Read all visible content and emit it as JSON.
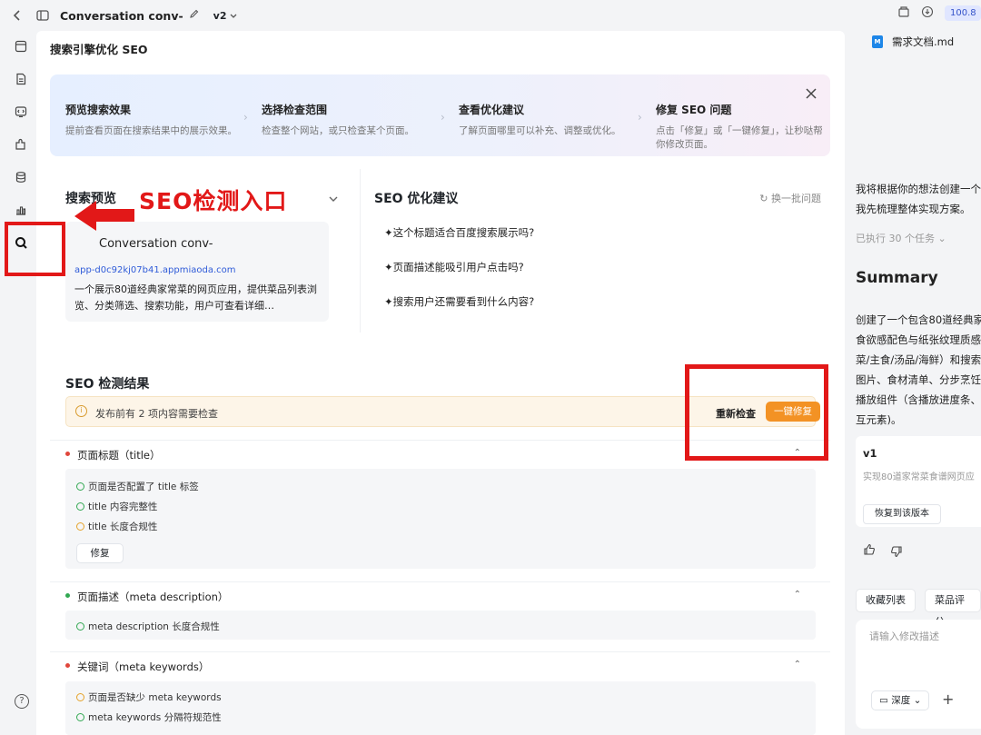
{
  "topbar": {
    "title": "Conversation conv-",
    "version": "v2",
    "zoom": "100.8"
  },
  "main": {
    "page_title": "搜索引擎优化 SEO",
    "steps": [
      {
        "title": "预览搜索效果",
        "desc": "提前查看页面在搜索结果中的展示效果。"
      },
      {
        "title": "选择检查范围",
        "desc": "检查整个网站，或只检查某个页面。"
      },
      {
        "title": "查看优化建议",
        "desc": "了解页面哪里可以补充、调整或优化。"
      },
      {
        "title": "修复 SEO 问题",
        "desc": "点击「修复」或「一键修复」，让秒哒帮你修改页面。"
      }
    ],
    "preview": {
      "title": "搜索预览",
      "site_name": "Conversation conv-",
      "url": "app-d0c92kj07b41.appmiaoda.com",
      "description": "一个展示80道经典家常菜的网页应用，提供菜品列表浏览、分类筛选、搜索功能，用户可查看详细…"
    },
    "suggestions": {
      "title": "SEO 优化建议",
      "refresh": "换一批问题",
      "items": [
        "这个标题适合百度搜索展示吗?",
        "页面描述能吸引用户点击吗?",
        "搜索用户还需要看到什么内容?"
      ]
    },
    "annotation": "SEO检测入口",
    "results": {
      "title": "SEO 检测结果",
      "warning": "发布前有 2 项内容需要检查",
      "recheck": "重新检查",
      "fix_all": "一键修复",
      "sections": [
        {
          "label": "页面标题（title）",
          "checks": [
            "页面是否配置了 title 标签",
            "title 内容完整性",
            "title 长度合规性"
          ],
          "fix": "修复"
        },
        {
          "label": "页面描述（meta description）",
          "checks": [
            "meta description 长度合规性"
          ]
        },
        {
          "label": "关键词（meta keywords）",
          "checks": [
            "页面是否缺少 meta keywords",
            "meta keywords 分隔符规范性"
          ]
        }
      ]
    }
  },
  "right": {
    "doc": "需求文档.md",
    "intro_line1": "我将根据你的想法创建一个",
    "intro_line2": "我先梳理整体实现方案。",
    "tasks": "已执行 30 个任务",
    "summary_title": "Summary",
    "summary_lines": [
      "创建了一个包含80道经典家",
      "食欲感配色与纸张纹理质感",
      "菜/主食/汤品/海鲜）和搜索",
      "图片、食材清单、分步烹饪",
      "播放组件（含播放进度条、",
      "互元素)。"
    ],
    "version_label": "v1",
    "version_desc": "实现80道家常菜食谱网页应",
    "restore": "恢复到该版本",
    "chips": [
      "收藏列表",
      "菜品评分"
    ],
    "input_placeholder": "请输入修改描述",
    "depth": "深度"
  },
  "colors": {
    "accent_orange": "#f39224",
    "annotation_red": "#e21818",
    "link_blue": "#2f5bd8"
  }
}
